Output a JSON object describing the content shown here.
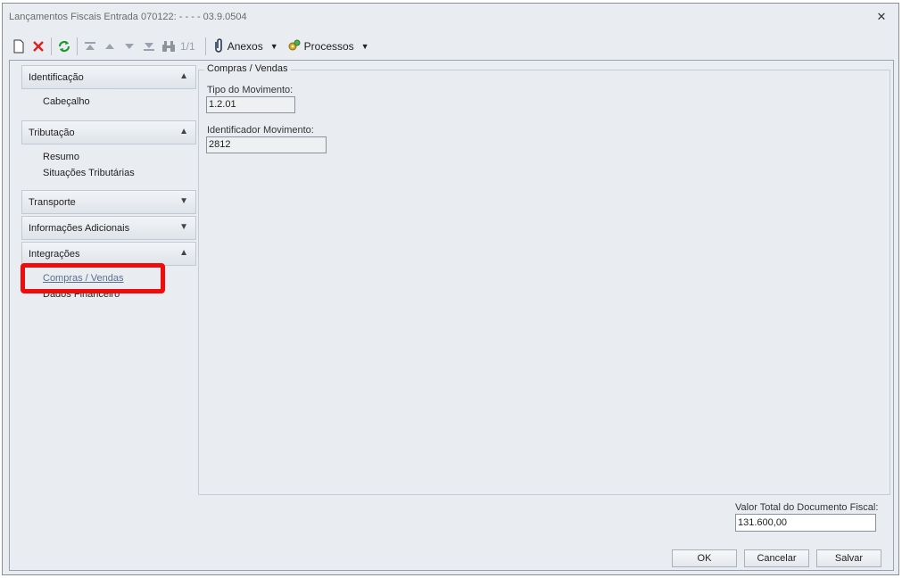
{
  "window": {
    "title": "Lançamentos Fiscais Entrada 070122: - - - - 03.9.0504"
  },
  "toolbar": {
    "record_count": "1/1",
    "anexos_label": "Anexos",
    "processos_label": "Processos"
  },
  "sidebar": {
    "groups": [
      {
        "label": "Identificação",
        "expanded": true,
        "items": [
          "Cabeçalho"
        ]
      },
      {
        "label": "Tributação",
        "expanded": true,
        "items": [
          "Resumo",
          "Situações Tributárias"
        ]
      },
      {
        "label": "Transporte",
        "expanded": false,
        "items": []
      },
      {
        "label": "Informações Adicionais",
        "expanded": false,
        "items": []
      },
      {
        "label": "Integrações",
        "expanded": true,
        "items": [
          "Compras / Vendas",
          "Dados Financeiro"
        ]
      }
    ],
    "active_item": "Compras / Vendas"
  },
  "panel": {
    "legend": "Compras / Vendas",
    "tipo_label": "Tipo do Movimento:",
    "tipo_value": "1.2.01",
    "ident_label": "Identificador Movimento:",
    "ident_value": "2812"
  },
  "footer": {
    "total_label": "Valor Total do Documento Fiscal:",
    "total_value": "131.600,00",
    "ok_label": "OK",
    "cancel_label": "Cancelar",
    "save_label": "Salvar"
  },
  "colors": {
    "highlight": "#f00c0c",
    "background": "#e9edf2"
  }
}
